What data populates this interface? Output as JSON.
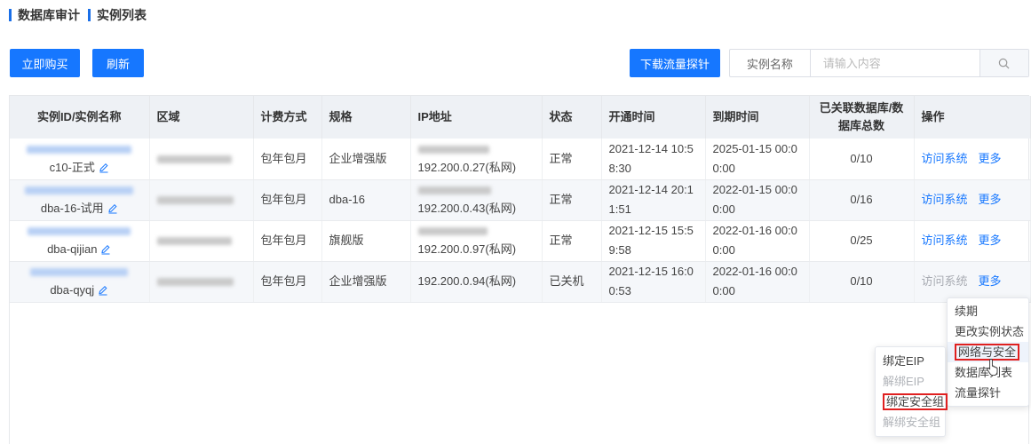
{
  "breadcrumb": {
    "level1": "数据库审计",
    "level2": "实例列表"
  },
  "toolbar": {
    "buy_label": "立即购买",
    "refresh_label": "刷新",
    "download_label": "下载流量探针",
    "search_prefix": "实例名称",
    "search_placeholder": "请输入内容",
    "search_value": ""
  },
  "table": {
    "headers": [
      "实例ID/实例名称",
      "区域",
      "计费方式",
      "规格",
      "IP地址",
      "状态",
      "开通时间",
      "到期时间",
      "已关联数据库/数据库总数",
      "操作"
    ],
    "rows": [
      {
        "name": "c10-正式",
        "billing": "包年包月",
        "spec": "企业增强版",
        "ip": "192.200.0.27(私网)",
        "status": "正常",
        "open_time": "2021-12-14 10:58:30",
        "expire_time": "2025-01-15 00:00:00",
        "db_count": "0/10",
        "op_visit": "访问系统",
        "op_more": "更多",
        "visit_disabled": false,
        "has_public_ip": true
      },
      {
        "name": "dba-16-试用",
        "billing": "包年包月",
        "spec": "dba-16",
        "ip": "192.200.0.43(私网)",
        "status": "正常",
        "open_time": "2021-12-14 20:11:51",
        "expire_time": "2022-01-15 00:00:00",
        "db_count": "0/16",
        "op_visit": "访问系统",
        "op_more": "更多",
        "visit_disabled": false,
        "has_public_ip": true
      },
      {
        "name": "dba-qijian",
        "billing": "包年包月",
        "spec": "旗舰版",
        "ip": "192.200.0.97(私网)",
        "status": "正常",
        "open_time": "2021-12-15 15:59:58",
        "expire_time": "2022-01-16 00:00:00",
        "db_count": "0/25",
        "op_visit": "访问系统",
        "op_more": "更多",
        "visit_disabled": false,
        "has_public_ip": true
      },
      {
        "name": "dba-qyqj",
        "billing": "包年包月",
        "spec": "企业增强版",
        "ip": "192.200.0.94(私网)",
        "status": "已关机",
        "open_time": "2021-12-15 16:00:53",
        "expire_time": "2022-01-16 00:00:00",
        "db_count": "0/10",
        "op_visit": "访问系统",
        "op_more": "更多",
        "visit_disabled": true,
        "has_public_ip": false
      }
    ]
  },
  "more_menu": {
    "items": [
      {
        "label": "续期",
        "active": false,
        "boxed": false
      },
      {
        "label": "更改实例状态",
        "active": false,
        "boxed": false
      },
      {
        "label": "网络与安全",
        "active": true,
        "boxed": true
      },
      {
        "label": "数据库列表",
        "active": false,
        "boxed": false
      },
      {
        "label": "流量探针",
        "active": false,
        "boxed": false
      }
    ]
  },
  "sub_menu": {
    "items": [
      {
        "label": "绑定EIP",
        "disabled": false,
        "boxed": false
      },
      {
        "label": "解绑EIP",
        "disabled": true,
        "boxed": false
      },
      {
        "label": "绑定安全组",
        "disabled": false,
        "boxed": true
      },
      {
        "label": "解绑安全组",
        "disabled": true,
        "boxed": false
      }
    ]
  },
  "colors": {
    "primary": "#1677ff",
    "header_bg": "#eef1f5",
    "highlight_box": "#e02020",
    "disabled": "#a8abb2"
  },
  "icons": {
    "search": "search-icon",
    "edit": "edit-icon",
    "cursor": "hand-pointer-icon"
  }
}
